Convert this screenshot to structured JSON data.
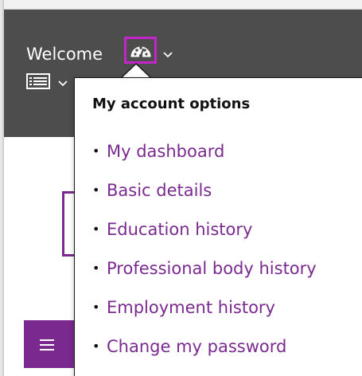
{
  "header": {
    "welcome_text": "Welcome",
    "dashboard_icon": "dashboard-gauge-icon",
    "menu_icon": "list-icon",
    "chevron_icon": "chevron-down-icon"
  },
  "account_menu": {
    "title": "My account options",
    "items": [
      {
        "label": "My dashboard"
      },
      {
        "label": "Basic details"
      },
      {
        "label": "Education history"
      },
      {
        "label": "Professional body history"
      },
      {
        "label": "Employment history"
      },
      {
        "label": "Change my password"
      }
    ]
  },
  "colors": {
    "header_bg": "#4d4d4d",
    "link": "#7a2a8f",
    "highlight": "#c226c8"
  }
}
